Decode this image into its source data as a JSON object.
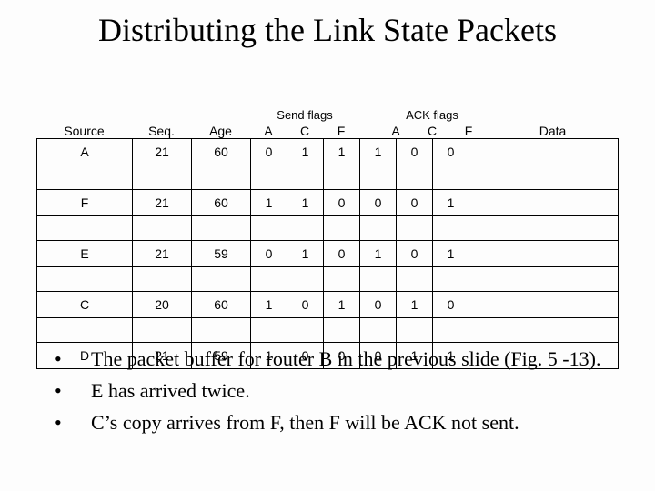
{
  "title": "Distributing the Link State Packets",
  "table": {
    "headers": {
      "source": "Source",
      "seq": "Seq.",
      "age": "Age",
      "send_flags": "Send flags",
      "ack_flags": "ACK flags",
      "flag_cols": [
        "A",
        "C",
        "F"
      ],
      "data": "Data"
    },
    "rows": [
      {
        "source": "A",
        "seq": "21",
        "age": "60",
        "send": [
          "0",
          "1",
          "1"
        ],
        "ack": [
          "1",
          "0",
          "0"
        ],
        "data": ""
      },
      {
        "source": "F",
        "seq": "21",
        "age": "60",
        "send": [
          "1",
          "1",
          "0"
        ],
        "ack": [
          "0",
          "0",
          "1"
        ],
        "data": ""
      },
      {
        "source": "E",
        "seq": "21",
        "age": "59",
        "send": [
          "0",
          "1",
          "0"
        ],
        "ack": [
          "1",
          "0",
          "1"
        ],
        "data": ""
      },
      {
        "source": "C",
        "seq": "20",
        "age": "60",
        "send": [
          "1",
          "0",
          "1"
        ],
        "ack": [
          "0",
          "1",
          "0"
        ],
        "data": ""
      },
      {
        "source": "D",
        "seq": "21",
        "age": "59",
        "send": [
          "1",
          "0",
          "0"
        ],
        "ack": [
          "0",
          "1",
          "1"
        ],
        "data": ""
      }
    ]
  },
  "bullets": [
    "The packet buffer for router B in the previous slide (Fig.  5 -13).",
    "E has arrived twice.",
    "C’s copy arrives from F, then F will be ACK not sent."
  ],
  "bullet_marker": "•"
}
